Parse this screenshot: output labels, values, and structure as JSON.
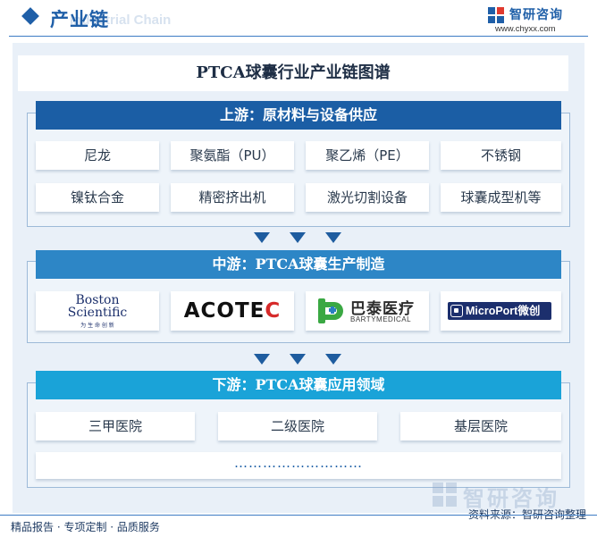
{
  "header": {
    "title": "产业链",
    "title_en": "Industrial Chain",
    "logo_name": "智研咨询",
    "logo_url": "www.chyxx.com"
  },
  "page_title": "PTCA球囊行业产业链图谱",
  "upstream": {
    "title": "上游：原材料与设备供应",
    "items": [
      "尼龙",
      "聚氨酯（PU）",
      "聚乙烯（PE）",
      "不锈钢",
      "镍钛合金",
      "精密挤出机",
      "激光切割设备",
      "球囊成型机等"
    ]
  },
  "midstream": {
    "title": "中游：PTCA球囊生产制造",
    "companies": {
      "boston": {
        "line1": "Boston",
        "line2": "Scientific",
        "line3": "为 生 命 创 新"
      },
      "acotec": {
        "text_main": "ACOTE",
        "text_accent": "C"
      },
      "barty": {
        "cn": "巴泰医疗",
        "en": "BARTYMEDICAL"
      },
      "microport": {
        "en": "MicroPort",
        "cn": "微创"
      }
    }
  },
  "downstream": {
    "title": "下游：PTCA球囊应用领域",
    "items": [
      "三甲医院",
      "二级医院",
      "基层医院"
    ],
    "more": "………………………"
  },
  "watermark": "智研咨询",
  "footer": {
    "left": "精品报告 · 专项定制 · 品质服务",
    "right": "资料来源：智研咨询整理"
  },
  "colors": {
    "primary": "#1b5ea5",
    "mid": "#2d86c6",
    "down": "#1aa3d8",
    "frame_bg": "#e9f0f8",
    "acotec_accent": "#d62a2a",
    "barty_green": "#3aa843",
    "microport_navy": "#1c2f6d"
  }
}
